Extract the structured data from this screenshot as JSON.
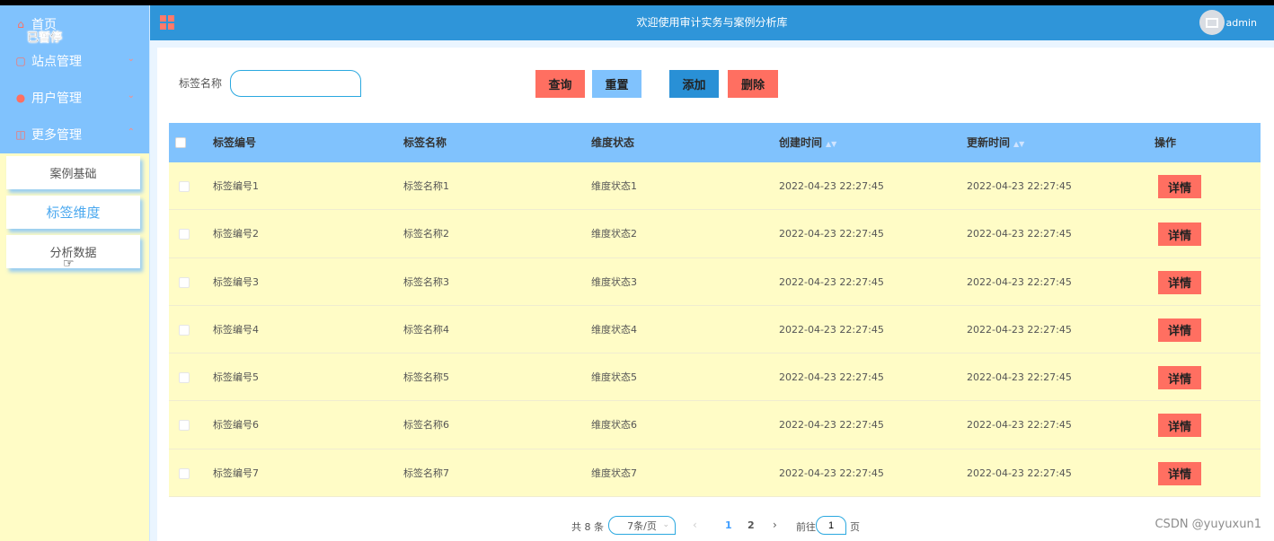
{
  "header": {
    "title": "欢迎使用审计实务与案例分析库",
    "username": "admin"
  },
  "overlay": {
    "paused": "已暂停"
  },
  "sidebar": {
    "items": [
      {
        "label": "首页",
        "icon": "home-icon"
      },
      {
        "label": "站点管理",
        "icon": "site-icon"
      },
      {
        "label": "用户管理",
        "icon": "user-icon"
      },
      {
        "label": "更多管理",
        "icon": "more-icon"
      }
    ],
    "sub_items": [
      {
        "label": "案例基础"
      },
      {
        "label": "标签维度"
      },
      {
        "label": "分析数据"
      }
    ]
  },
  "search": {
    "label": "标签名称",
    "value": "",
    "placeholder": ""
  },
  "buttons": {
    "query": "查询",
    "reset": "重置",
    "add": "添加",
    "delete": "删除"
  },
  "table": {
    "columns": [
      "标签编号",
      "标签名称",
      "维度状态",
      "创建时间",
      "更新时间",
      "操作"
    ],
    "detail_label": "详情",
    "rows": [
      {
        "id": "标签编号1",
        "name": "标签名称1",
        "status": "维度状态1",
        "created": "2022-04-23 22:27:45",
        "updated": "2022-04-23 22:27:45"
      },
      {
        "id": "标签编号2",
        "name": "标签名称2",
        "status": "维度状态2",
        "created": "2022-04-23 22:27:45",
        "updated": "2022-04-23 22:27:45"
      },
      {
        "id": "标签编号3",
        "name": "标签名称3",
        "status": "维度状态3",
        "created": "2022-04-23 22:27:45",
        "updated": "2022-04-23 22:27:45"
      },
      {
        "id": "标签编号4",
        "name": "标签名称4",
        "status": "维度状态4",
        "created": "2022-04-23 22:27:45",
        "updated": "2022-04-23 22:27:45"
      },
      {
        "id": "标签编号5",
        "name": "标签名称5",
        "status": "维度状态5",
        "created": "2022-04-23 22:27:45",
        "updated": "2022-04-23 22:27:45"
      },
      {
        "id": "标签编号6",
        "name": "标签名称6",
        "status": "维度状态6",
        "created": "2022-04-23 22:27:45",
        "updated": "2022-04-23 22:27:45"
      },
      {
        "id": "标签编号7",
        "name": "标签名称7",
        "status": "维度状态7",
        "created": "2022-04-23 22:27:45",
        "updated": "2022-04-23 22:27:45"
      }
    ]
  },
  "pagination": {
    "total": "共 8 条",
    "page_size": "7条/页",
    "pages": [
      "1",
      "2"
    ],
    "goto_label": "前往",
    "goto_value": "1",
    "goto_unit": "页"
  },
  "watermark": "CSDN @yuyuxun1",
  "colors": {
    "header": "#2f95d9",
    "sidebar_top": "#80c2fd",
    "sidebar_bg": "#fffcc6",
    "accent_red": "#ff6f61",
    "table_head": "#80c2fd",
    "row_bg": "#fffcc6"
  }
}
